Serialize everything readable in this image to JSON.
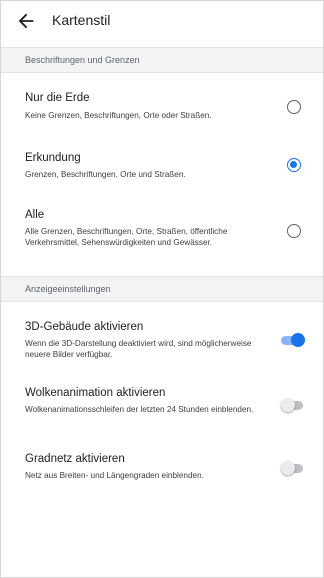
{
  "header": {
    "title": "Kartenstil",
    "back_icon": "arrow-left-icon"
  },
  "sections": {
    "labels": "Beschriftungen und Grenzen",
    "display": "Anzeigeeinstellungen"
  },
  "map_style_options": [
    {
      "title": "Nur die Erde",
      "subtitle": "Keine Grenzen, Beschriftungen, Orte oder Straßen.",
      "selected": false
    },
    {
      "title": "Erkundung",
      "subtitle": "Grenzen, Beschriftungen, Orte und Straßen.",
      "selected": true
    },
    {
      "title": "Alle",
      "subtitle": "Alle Grenzen, Beschriftungen, Orte, Straßen, öffentliche Verkehrsmittel, Sehenswürdigkeiten und Gewässer.",
      "selected": false
    }
  ],
  "display_settings": [
    {
      "title": "3D-Gebäude aktivieren",
      "subtitle": "Wenn die 3D-Darstellung deaktiviert wird, sind möglicherweise neuere Bilder verfügbar.",
      "enabled": true
    },
    {
      "title": "Wolkenanimation aktivieren",
      "subtitle": "Wolkenanimationsschleifen der letzten 24 Stunden einblenden.",
      "enabled": false
    },
    {
      "title": "Gradnetz aktivieren",
      "subtitle": "Netz aus Breiten- und Längengraden einblenden.",
      "enabled": false
    }
  ],
  "colors": {
    "accent": "#1a73e8",
    "accent_track": "#8ab4f8",
    "section_bg": "#f1f3f4"
  }
}
